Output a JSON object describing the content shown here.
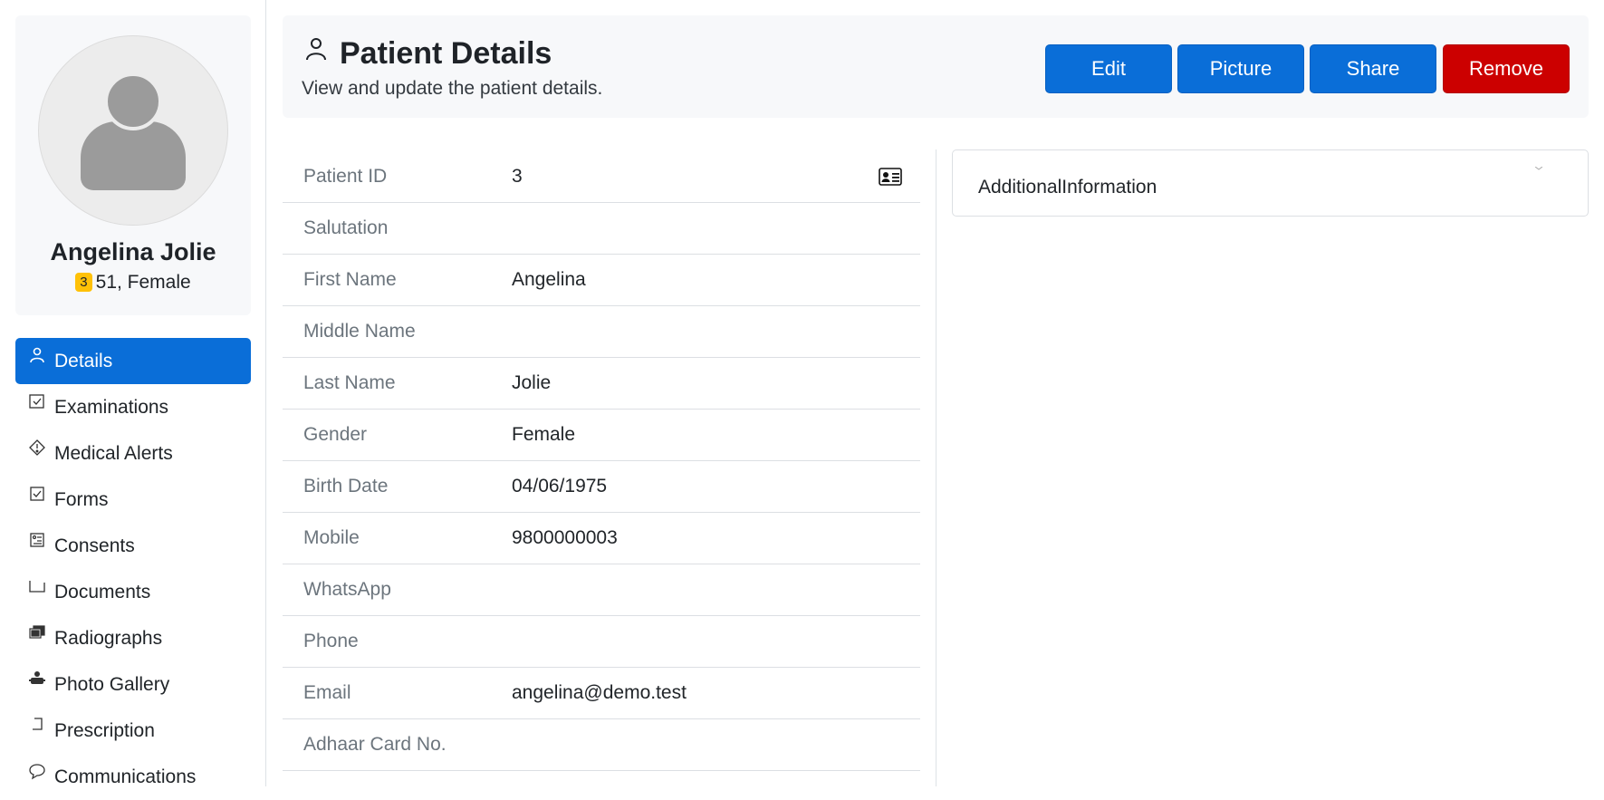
{
  "profile": {
    "name": "Angelina Jolie",
    "id_badge": "3",
    "age_gender": "51, Female"
  },
  "nav": {
    "items": [
      {
        "label": "Details",
        "icon": "person-icon",
        "active": true
      },
      {
        "label": "Examinations",
        "icon": "checkbox-icon"
      },
      {
        "label": "Medical Alerts",
        "icon": "alert-icon"
      },
      {
        "label": "Forms",
        "icon": "form-check-icon"
      },
      {
        "label": "Consents",
        "icon": "consent-icon"
      },
      {
        "label": "Documents",
        "icon": "folder-icon"
      },
      {
        "label": "Radiographs",
        "icon": "images-icon"
      },
      {
        "label": "Photo Gallery",
        "icon": "camera-icon"
      },
      {
        "label": "Prescription",
        "icon": "prescription-icon"
      },
      {
        "label": "Communications",
        "icon": "chat-icon"
      }
    ]
  },
  "header": {
    "title": "Patient Details",
    "subtitle": "View and update the patient details.",
    "buttons": {
      "edit": "Edit",
      "picture": "Picture",
      "share": "Share",
      "remove": "Remove"
    }
  },
  "details": {
    "rows": [
      {
        "label": "Patient ID",
        "value": "3"
      },
      {
        "label": "Salutation",
        "value": ""
      },
      {
        "label": "First Name",
        "value": "Angelina"
      },
      {
        "label": "Middle Name",
        "value": ""
      },
      {
        "label": "Last Name",
        "value": "Jolie"
      },
      {
        "label": "Gender",
        "value": "Female"
      },
      {
        "label": "Birth Date",
        "value": "04/06/1975"
      },
      {
        "label": "Mobile",
        "value": "9800000003"
      },
      {
        "label": "WhatsApp",
        "value": ""
      },
      {
        "label": "Phone",
        "value": ""
      },
      {
        "label": "Email",
        "value": "angelina@demo.test"
      },
      {
        "label": "Adhaar Card No.",
        "value": ""
      }
    ]
  },
  "additional": {
    "title": "AdditionalInformation"
  },
  "colors": {
    "primary": "#0a6ed8",
    "danger": "#cc0000",
    "badge": "#ffc107",
    "muted": "#6c757d"
  }
}
